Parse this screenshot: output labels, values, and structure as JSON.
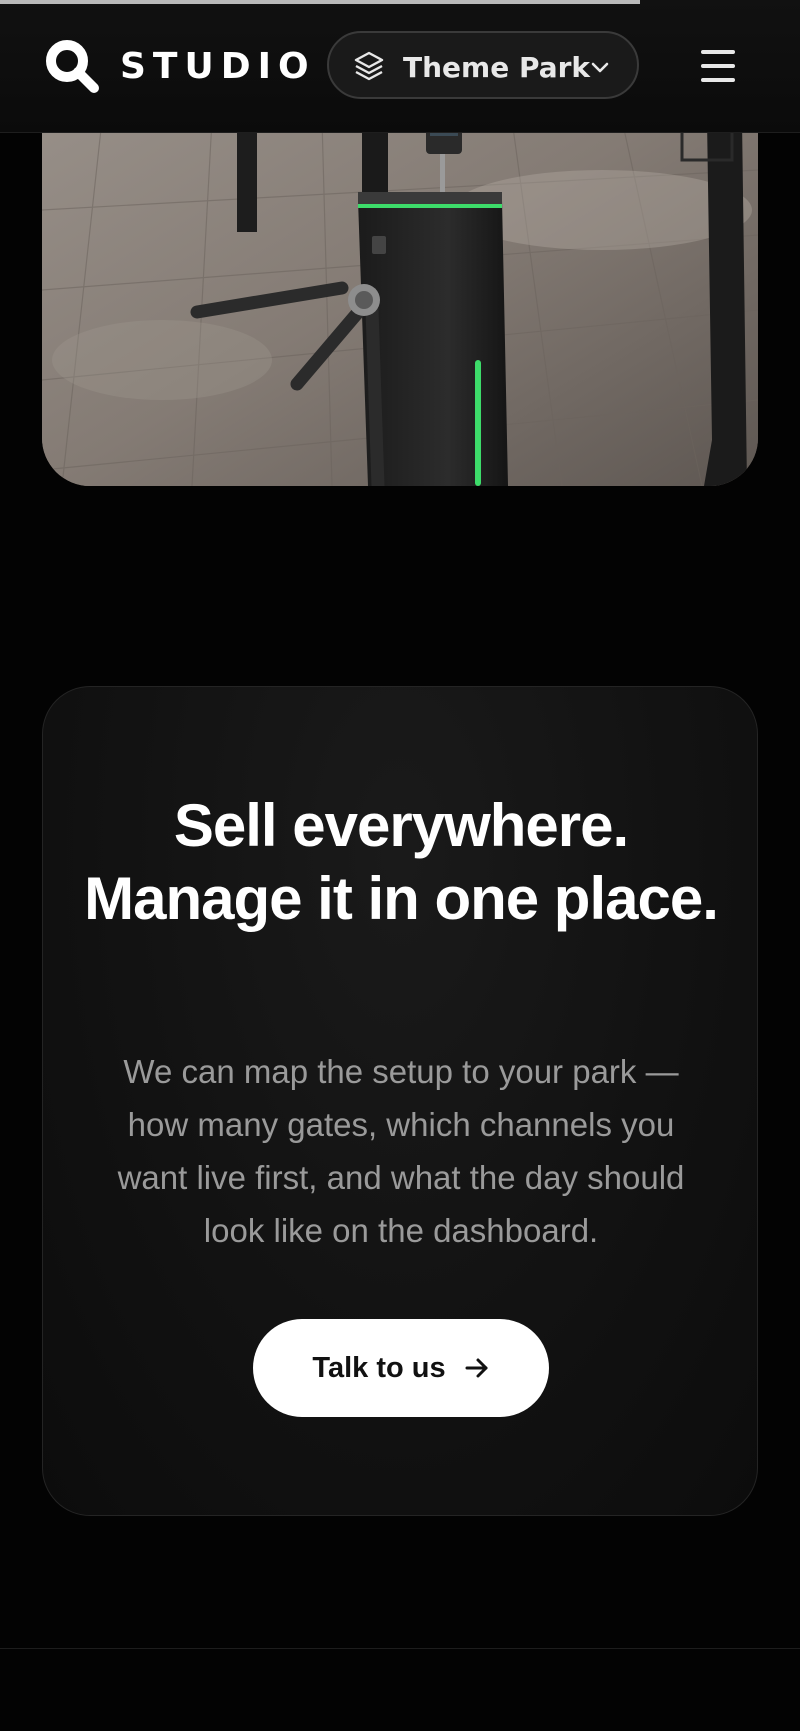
{
  "progress": {
    "fraction": 0.8
  },
  "header": {
    "logo_text": "STUDIO",
    "logo_icon": "magnifier-logo-icon",
    "selector_label": "Theme Park",
    "selector_icon": "layers-icon",
    "selector_chevron": "chevron-down-icon",
    "menu_icon": "hamburger-menu-icon"
  },
  "hero": {
    "image": "turnstile-gate-photo",
    "accent_color": "#3ddc6a"
  },
  "cta_card": {
    "title": "Sell everywhere. Manage it in one place.",
    "body": "We can map the setup to your park — how many gates, which channels you want live first, and what the day should look like on the dashboard.",
    "button_label": "Talk to us",
    "button_icon": "arrow-right-icon"
  }
}
